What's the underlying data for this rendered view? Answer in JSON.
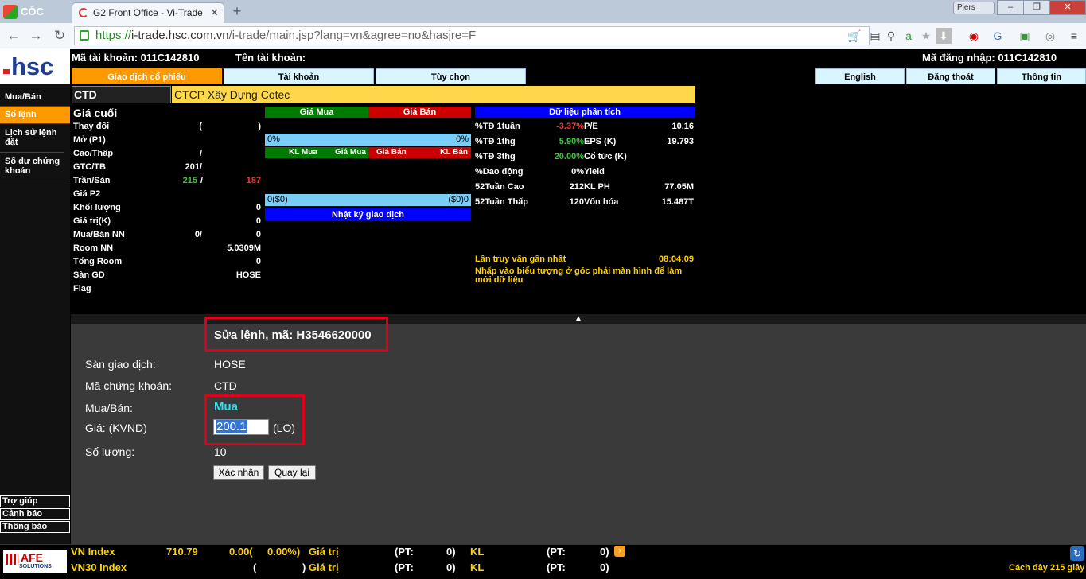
{
  "browser": {
    "brand": "CỐC CỐC",
    "tab_title": "G2 Front Office - Vi-Trade",
    "profile": "Piers",
    "url_proto": "https://",
    "url_host": "i-trade.hsc.com.vn",
    "url_path": "/i-trade/main.jsp?lang=vn&agree=no&hasjre=F"
  },
  "header": {
    "account_no": "Mã tài khoản: 011C142810",
    "account_name": "Tên tài khoản:",
    "login_id": "Mã đăng nhập: 011C142810",
    "logo": "hsc"
  },
  "menu": {
    "stock_trading": "Giao dịch cổ phiếu",
    "account": "Tài khoản",
    "options": "Tùy chọn",
    "english": "English",
    "logout": "Đăng thoát",
    "info": "Thông tin"
  },
  "sidebar": {
    "items": [
      {
        "label": "Mua/Bán"
      },
      {
        "label": "Sổ lệnh"
      },
      {
        "label": "Lịch sử lệnh đặt"
      },
      {
        "label": "Số dư chứng khoán"
      }
    ],
    "bottom": [
      {
        "label": "Trợ giúp"
      },
      {
        "label": "Cảnh báo"
      },
      {
        "label": "Thông báo"
      }
    ]
  },
  "stock": {
    "code": "CTD",
    "name": "CTCP Xây Dựng Cotec",
    "last_price_label": "Giá cuối",
    "rows": [
      {
        "label": "Thay đổi",
        "v1": "(",
        "v2": ")"
      },
      {
        "label": "Mở (P1)",
        "v1": "",
        "v2": ""
      },
      {
        "label": "Cao/Thấp",
        "v1": "/",
        "v2": ""
      },
      {
        "label": "GTC/TB",
        "v1": "201/",
        "v2": ""
      },
      {
        "label": "Trần/Sàn",
        "v1": "215",
        "v1b": "/",
        "v2": "187"
      },
      {
        "label": "Giá P2",
        "v1": "",
        "v2": ""
      },
      {
        "label": "Khối lượng",
        "v1": "",
        "v2": "0"
      },
      {
        "label": "Giá trị(K)",
        "v1": "",
        "v2": "0"
      },
      {
        "label": "Mua/Bán NN",
        "v1": "0/",
        "v2": "0"
      },
      {
        "label": "Room NN",
        "v1": "",
        "v2": "5.0309M"
      },
      {
        "label": "Tổng Room",
        "v1": "",
        "v2": "0"
      },
      {
        "label": "Sàn GD",
        "v1": "",
        "v2": "HOSE"
      },
      {
        "label": "Flag",
        "v1": "",
        "v2": ""
      }
    ]
  },
  "orderbook": {
    "buy_price": "Giá Mua",
    "sell_price": "Giá Bán",
    "ratio_left": "0%",
    "ratio_right": "0%",
    "col_buy_vol": "KL Mua",
    "col_buy_price": "Giá Mua",
    "col_sell_price": "Giá Bán",
    "col_sell_vol": "KL Bán",
    "total_left": "0($0)",
    "total_right": "($0)0",
    "journal": "Nhật ký giao dịch"
  },
  "analysis": {
    "title": "Dữ liệu phân tích",
    "rows": [
      {
        "l1": "%TĐ 1tuần",
        "v1": "-3.37%",
        "l2": "P/E",
        "v2": "10.16"
      },
      {
        "l1": "%TĐ 1thg",
        "v1": "5.90%",
        "l2": "EPS (K)",
        "v2": "19.793"
      },
      {
        "l1": "%TĐ 3thg",
        "v1": "20.00%",
        "l2": "Cổ tức (K)",
        "v2": ""
      },
      {
        "l1": "%Dao động",
        "v1": "0%",
        "l2": "Yield",
        "v2": ""
      },
      {
        "l1": "52Tuần Cao",
        "v1": "212",
        "l2": "KL PH",
        "v2": "77.05M"
      },
      {
        "l1": "52Tuần Thấp",
        "v1": "120",
        "l2": "Vốn hóa",
        "v2": "15.487T"
      }
    ],
    "last_query_label": "Lần truy vấn gần nhất",
    "last_query_time": "08:04:09",
    "refresh_hint": "Nhấp vào biểu tượng ở góc phải màn hình để làm mới dữ liệu"
  },
  "edit_order": {
    "title": "Sửa lệnh, mã: H3546620000",
    "exchange_label": "Sàn giao dịch:",
    "exchange_value": "HOSE",
    "symbol_label": "Mã chứng khoán:",
    "symbol_value": "CTD",
    "side_label": "Mua/Bán:",
    "side_value": "Mua",
    "price_label": "Giá:  (KVND)",
    "price_value": "200.1",
    "price_type": "(LO)",
    "qty_label": "Số lượng:",
    "qty_value": "10",
    "confirm_button": "Xác nhận",
    "back_button": "Quay lại"
  },
  "ticker": {
    "afe": "AFE",
    "afe_sub": "SOLUTIONS",
    "vn_index": "VN Index",
    "vn_value": "710.79",
    "vn_change": "0.00(",
    "vn_pct": "0.00%)",
    "value_label": "Giá trị",
    "pt1": "(PT:",
    "pt1_val": "0)",
    "kl_label": "KL",
    "pt2": "(PT:",
    "pt2_val": "0)",
    "vn30_index": "VN30 Index",
    "vn30_change": "(",
    "vn30_close": ")",
    "updated": "Cách đây 215 giây"
  },
  "colors": {
    "accent_orange": "#ff9900",
    "buy_green": "#007a00",
    "sell_red": "#cc0000",
    "analysis_blue": "#0000ff",
    "highlight_red": "#e0001b"
  }
}
